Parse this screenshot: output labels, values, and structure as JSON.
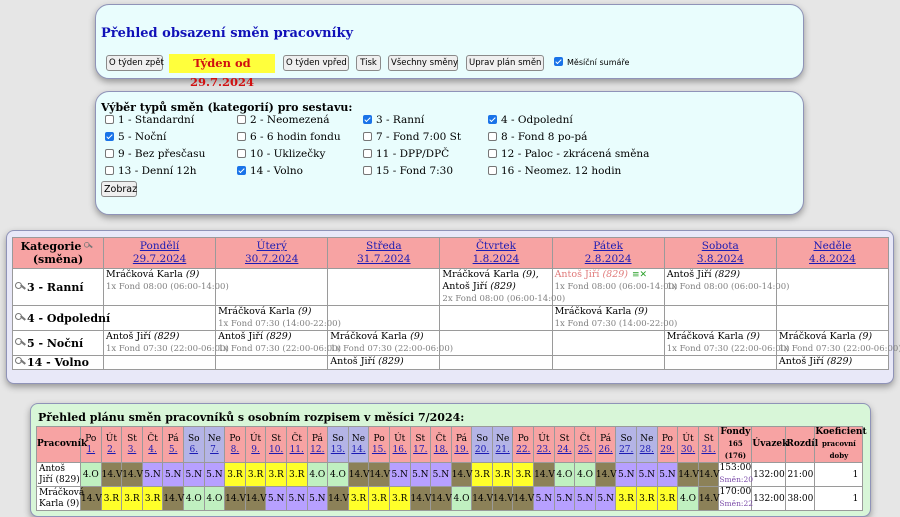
{
  "header": {
    "title": "Přehled obsazení směn pracovníky",
    "prev_week": "O týden zpět",
    "week_label": "Týden od 29.7.2024",
    "next_week": "O týden vpřed",
    "print": "Tisk",
    "all_shifts": "Všechny směny",
    "edit_plan": "Uprav plán směn",
    "monthly_sums": "Měsíční sumáře",
    "monthly_sums_checked": true
  },
  "filter": {
    "title": "Výběr typů směn (kategorií) pro sestavu:",
    "submit": "Zobraz",
    "categories": [
      {
        "label": "1 - Standardní",
        "checked": false
      },
      {
        "label": "2 - Neomezená",
        "checked": false
      },
      {
        "label": "3 - Ranní",
        "checked": true
      },
      {
        "label": "4 - Odpolední",
        "checked": true
      },
      {
        "label": "5 - Noční",
        "checked": true
      },
      {
        "label": "6 - 6 hodin fondu",
        "checked": false
      },
      {
        "label": "7 - Fond 7:00 St",
        "checked": false
      },
      {
        "label": "8 - Fond 8 po-pá",
        "checked": false
      },
      {
        "label": "9 - Bez přesčasu",
        "checked": false
      },
      {
        "label": "10 - Uklizečky",
        "checked": false
      },
      {
        "label": "11 - DPP/DPČ",
        "checked": false
      },
      {
        "label": "12 - Paloc - zkrácená směna",
        "checked": false
      },
      {
        "label": "13 - Denní 12h",
        "checked": false
      },
      {
        "label": "14 - Volno",
        "checked": true
      },
      {
        "label": "15 - Fond 7:30",
        "checked": false
      },
      {
        "label": "16 - Neomez. 12 hodin",
        "checked": false
      }
    ]
  },
  "schedule": {
    "category_header_1": "Kategorie",
    "category_header_2": "(směna)",
    "days": [
      {
        "name": "Pondělí",
        "date": "29.7.2024"
      },
      {
        "name": "Úterý",
        "date": "30.7.2024"
      },
      {
        "name": "Středa",
        "date": "31.7.2024"
      },
      {
        "name": "Čtvrtek",
        "date": "1.8.2024"
      },
      {
        "name": "Pátek",
        "date": "2.8.2024"
      },
      {
        "name": "Sobota",
        "date": "3.8.2024"
      },
      {
        "name": "Neděle",
        "date": "4.8.2024"
      }
    ],
    "rows": [
      {
        "label": "3 - Ranní",
        "cells": [
          [
            {
              "name": "Mráčková Karla",
              "num": "(9)",
              "sep": "",
              "detail": "1x Fond 08:00 (06:00-14:00)",
              "pink": false
            }
          ],
          [],
          [],
          [
            {
              "name": "Mráčková Karla",
              "num": "(9)",
              "sep": ",",
              "detail": "",
              "pink": false
            },
            {
              "name": "Antoš Jiří",
              "num": "(829)",
              "sep": "",
              "detail": "2x Fond 08:00 (06:00-14:00)",
              "pink": false
            }
          ],
          [
            {
              "name": "Antoš Jiří",
              "num": "(829)",
              "sep": "",
              "detail": "1x Fond 08:00 (06:00-14:00)",
              "pink": true
            }
          ],
          [
            {
              "name": "Antoš Jiří",
              "num": "(829)",
              "sep": "",
              "detail": "1x Fond 08:00 (06:00-14:00)",
              "pink": false
            }
          ],
          []
        ]
      },
      {
        "label": "4 - Odpolední",
        "cells": [
          [],
          [
            {
              "name": "Mráčková Karla",
              "num": "(9)",
              "sep": "",
              "detail": "1x Fond 07:30 (14:00-22:00)",
              "pink": false
            }
          ],
          [],
          [],
          [
            {
              "name": "Mráčková Karla",
              "num": "(9)",
              "sep": "",
              "detail": "1x Fond 07:30 (14:00-22:00)",
              "pink": false
            }
          ],
          [],
          []
        ]
      },
      {
        "label": "5 - Noční",
        "cells": [
          [
            {
              "name": "Antoš Jiří",
              "num": "(829)",
              "sep": "",
              "detail": "1x Fond 07:30 (22:00-06:00)",
              "pink": false
            }
          ],
          [
            {
              "name": "Antoš Jiří",
              "num": "(829)",
              "sep": "",
              "detail": "1x Fond 07:30 (22:00-06:00)",
              "pink": false
            }
          ],
          [
            {
              "name": "Mráčková Karla",
              "num": "(9)",
              "sep": "",
              "detail": "1x Fond 07:30 (22:00-06:00)",
              "pink": false
            }
          ],
          [],
          [],
          [
            {
              "name": "Mráčková Karla",
              "num": "(9)",
              "sep": "",
              "detail": "1x Fond 07:30 (22:00-06:00)",
              "pink": false
            }
          ],
          [
            {
              "name": "Mráčková Karla",
              "num": "(9)",
              "sep": "",
              "detail": "1x Fond 07:30 (22:00-06:00)",
              "pink": false
            }
          ]
        ]
      },
      {
        "label": "14 - Volno",
        "cells": [
          [],
          [],
          [
            {
              "name": "Antoš Jiří",
              "num": "(829)",
              "sep": "",
              "detail": "",
              "pink": false
            }
          ],
          [],
          [],
          [],
          [
            {
              "name": "Antoš Jiří",
              "num": "(829)",
              "sep": "",
              "detail": "",
              "pink": false
            }
          ]
        ]
      }
    ]
  },
  "monthly": {
    "title": "Přehled plánu směn pracovníků s osobním rozpisem v měsíci 7/2024:",
    "employee_header": "Pracovník",
    "fund_header": "Fondy",
    "fund_sub": "165 (176)",
    "load_header": "Úvazek",
    "diff_header": "Rozdíl",
    "coef_header": "Koeficient",
    "coef_sub": "pracovní doby",
    "days": [
      {
        "d": "Po",
        "n": "1.",
        "wk": false
      },
      {
        "d": "Út",
        "n": "2.",
        "wk": false
      },
      {
        "d": "St",
        "n": "3.",
        "wk": false
      },
      {
        "d": "Čt",
        "n": "4.",
        "wk": false
      },
      {
        "d": "Pá",
        "n": "5.",
        "wk": false
      },
      {
        "d": "So",
        "n": "6.",
        "wk": true
      },
      {
        "d": "Ne",
        "n": "7.",
        "wk": true
      },
      {
        "d": "Po",
        "n": "8.",
        "wk": false
      },
      {
        "d": "Út",
        "n": "9.",
        "wk": false
      },
      {
        "d": "St",
        "n": "10.",
        "wk": false
      },
      {
        "d": "Čt",
        "n": "11.",
        "wk": false
      },
      {
        "d": "Pá",
        "n": "12.",
        "wk": false
      },
      {
        "d": "So",
        "n": "13.",
        "wk": true
      },
      {
        "d": "Ne",
        "n": "14.",
        "wk": true
      },
      {
        "d": "Po",
        "n": "15.",
        "wk": false
      },
      {
        "d": "Út",
        "n": "16.",
        "wk": false
      },
      {
        "d": "St",
        "n": "17.",
        "wk": false
      },
      {
        "d": "Čt",
        "n": "18.",
        "wk": false
      },
      {
        "d": "Pá",
        "n": "19.",
        "wk": false
      },
      {
        "d": "So",
        "n": "20.",
        "wk": true
      },
      {
        "d": "Ne",
        "n": "21.",
        "wk": true
      },
      {
        "d": "Po",
        "n": "22.",
        "wk": false
      },
      {
        "d": "Út",
        "n": "23.",
        "wk": false
      },
      {
        "d": "St",
        "n": "24.",
        "wk": false
      },
      {
        "d": "Čt",
        "n": "25.",
        "wk": false
      },
      {
        "d": "Pá",
        "n": "26.",
        "wk": false
      },
      {
        "d": "So",
        "n": "27.",
        "wk": true
      },
      {
        "d": "Ne",
        "n": "28.",
        "wk": true
      },
      {
        "d": "Po",
        "n": "29.",
        "wk": false
      },
      {
        "d": "Út",
        "n": "30.",
        "wk": false
      },
      {
        "d": "St",
        "n": "31.",
        "wk": false
      }
    ],
    "shift_colors": {
      "4.O": "#c0f0c0",
      "14.V": "#8c8158",
      "5.N": "#b7a0ff",
      "3.R": "#ffff2a"
    },
    "employees": [
      {
        "name1": "Antoš",
        "name2": "Jiří (829)",
        "shifts": [
          "4.O",
          "14.V",
          "14.V",
          "5.N",
          "5.N",
          "5.N",
          "5.N",
          "3.R",
          "3.R",
          "3.R",
          "3.R",
          "4.O",
          "4.O",
          "14.V",
          "14.V",
          "5.N",
          "5.N",
          "5.N",
          "14.V",
          "3.R",
          "3.R",
          "3.R",
          "14.V",
          "4.O",
          "4.O",
          "14.V",
          "5.N",
          "5.N",
          "5.N",
          "14.V",
          "14.V"
        ],
        "fund": "153:00",
        "fund_sub": "Směn:20",
        "load": "132:00",
        "diff": "21:00",
        "coef": "1"
      },
      {
        "name1": "Mráčková",
        "name2": "Karla (9)",
        "shifts": [
          "14.V",
          "3.R",
          "3.R",
          "3.R",
          "14.V",
          "4.O",
          "4.O",
          "14.V",
          "14.V",
          "5.N",
          "5.N",
          "5.N",
          "14.V",
          "3.R",
          "3.R",
          "3.R",
          "14.V",
          "14.V",
          "4.O",
          "14.V",
          "14.V",
          "14.V",
          "5.N",
          "5.N",
          "5.N",
          "5.N",
          "3.R",
          "3.R",
          "3.R",
          "4.O",
          "14.V"
        ],
        "fund": "170:00",
        "fund_sub": "Směn:22",
        "load": "132:00",
        "diff": "38:00",
        "coef": "1"
      }
    ]
  }
}
